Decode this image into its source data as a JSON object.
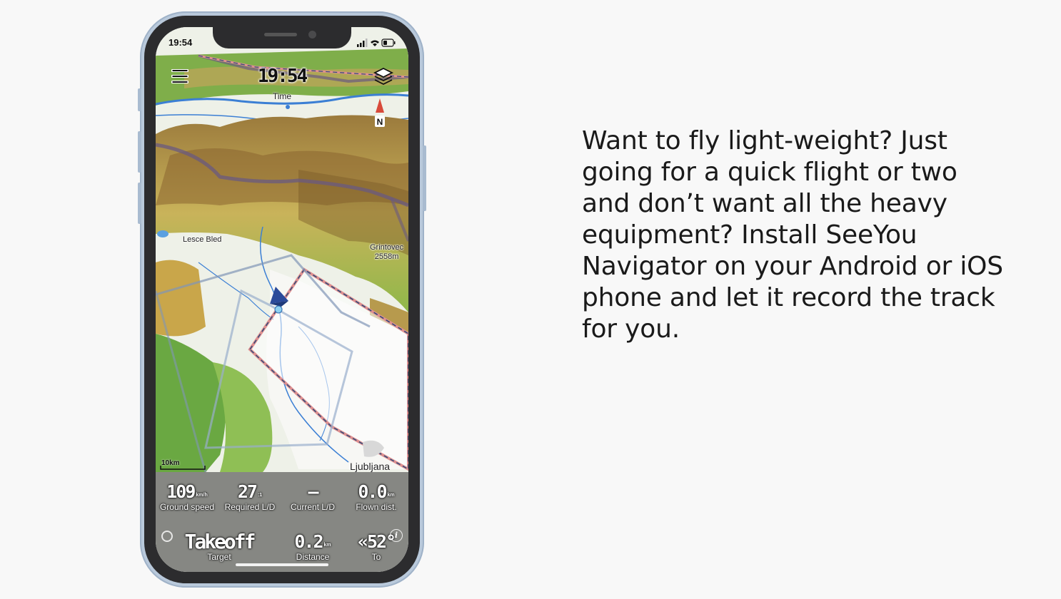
{
  "status_bar": {
    "time": "19:54"
  },
  "map": {
    "time_value": "19:54",
    "time_label": "Time",
    "north_label": "N",
    "places": {
      "lesce": "Lesce Bled",
      "grintovec": "Grintovec",
      "grintovec_alt": "2558m",
      "ljubljana": "Ljubljana"
    },
    "scale": "10km"
  },
  "data_panel": {
    "ground_speed": {
      "value": "109",
      "unit": "km/h",
      "label": "Ground speed"
    },
    "required_ld": {
      "value": "27",
      "unit": ":1",
      "label": "Required L/D"
    },
    "current_ld": {
      "value": "—",
      "label": "Current L/D"
    },
    "flown_dist": {
      "value": "0.0",
      "unit": "km",
      "label": "Flown dist."
    },
    "target": {
      "value": "Takeoff",
      "label": "Target"
    },
    "distance": {
      "value": "0.2",
      "unit": "km",
      "label": "Distance"
    },
    "to": {
      "value": "«52°",
      "label": "To"
    }
  },
  "promo_text": "Want to fly light-weight? Just going for a quick flight or two and don’t want all the heavy equipment? Install SeeYou Navigator on your Android or iOS phone and let it record the track for you.",
  "colors": {
    "background": "#f8f8f8",
    "phone_frame": "#b9c9db",
    "bezel": "#2c2c2e",
    "airspace_red": "#e08080",
    "airspace_blue": "#2b4a7a"
  }
}
